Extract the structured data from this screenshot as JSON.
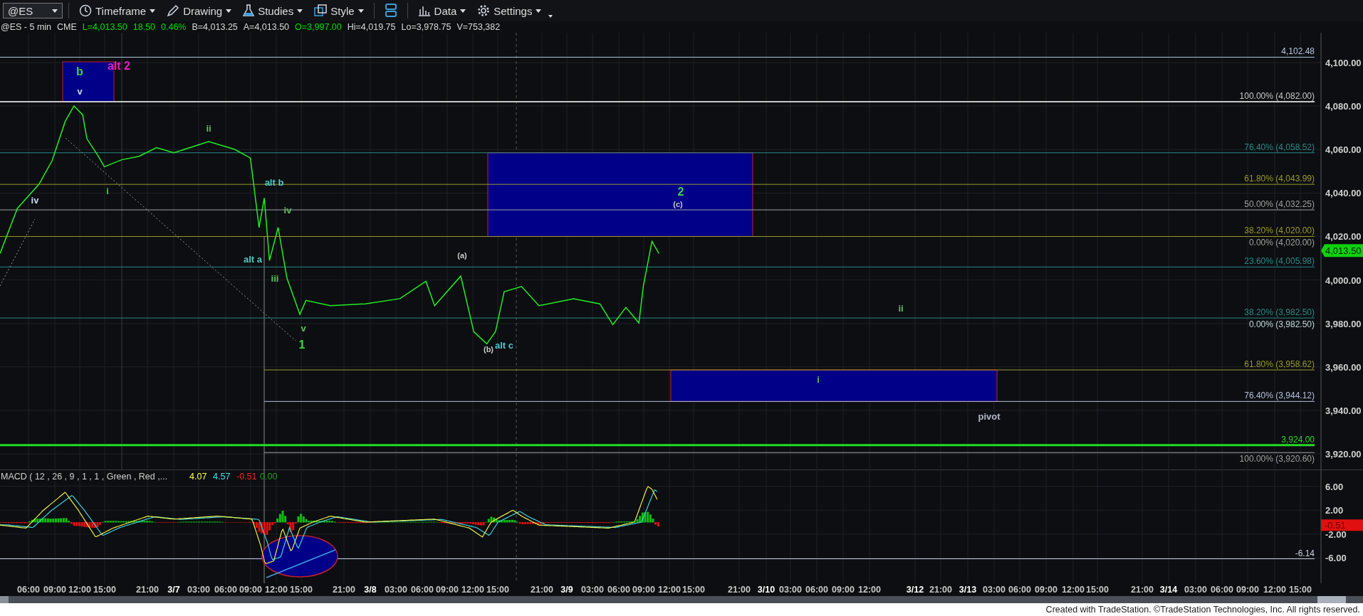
{
  "toolbar": {
    "symbol": "@ES",
    "buttons": [
      {
        "kind": "clock",
        "label": "Timeframe"
      },
      {
        "kind": "pencil",
        "label": "Drawing"
      },
      {
        "kind": "flask",
        "label": "Studies"
      },
      {
        "kind": "style",
        "label": "Style"
      },
      {
        "kind": "layout"
      },
      {
        "kind": "bars",
        "label": "Data"
      },
      {
        "kind": "gear",
        "label": "Settings"
      }
    ]
  },
  "quote_line": {
    "symbol": "@ES - 5 min",
    "exchange": "CME",
    "fields": [
      {
        "text": "L=4,013.50",
        "color": "#00e000"
      },
      {
        "text": "18.50",
        "color": "#00e000"
      },
      {
        "text": "0.46%",
        "color": "#00e000"
      },
      {
        "text": "B=4,013.25",
        "color": "#d8d8d8"
      },
      {
        "text": "A=4,013.50",
        "color": "#d8d8d8"
      },
      {
        "text": "O=3,997.00",
        "color": "#00e000"
      },
      {
        "text": "Hi=4,019.75",
        "color": "#d8d8d8"
      },
      {
        "text": "Lo=3,978.75",
        "color": "#d8d8d8"
      },
      {
        "text": "V=753,382",
        "color": "#d8d8d8"
      }
    ]
  },
  "price_chart": {
    "fib_levels": [
      {
        "label": "4,102.48",
        "color": "#b4c8e0"
      },
      {
        "label": "100.00% (4,082.00)",
        "color": "#c8c8c8"
      },
      {
        "label": "76.40% (4,058.52)",
        "color": "#2a8a86"
      },
      {
        "label": "61.80% (4,043.99)",
        "color": "#9a9a2a"
      },
      {
        "label": "50.00% (4,032.25)",
        "color": "#a0a0a0"
      },
      {
        "label": "38.20% (4,020.00)",
        "color": "#9a9a2a"
      },
      {
        "label": "0.00% (4,020.00)",
        "color": "#a0a0a0"
      },
      {
        "label": "23.60% (4,005.98)",
        "color": "#2a8a86"
      },
      {
        "label": "38.20% (3,982.50)",
        "color": "#2a8a86"
      },
      {
        "label": "0.00% (3,982.50)",
        "color": "#c0d8d8"
      },
      {
        "label": "61.80% (3,958.62)",
        "color": "#9a9a2a"
      },
      {
        "label": "76.40% (3,944.12)",
        "color": "#b4c0d8"
      },
      {
        "label": "3,924.00",
        "color": "#22dd22"
      },
      {
        "label": "100.00% (3,920.60)",
        "color": "#a0a0a0"
      }
    ],
    "wave_labels": [
      {
        "text": "b",
        "kind": "major",
        "color": "#3fd23f"
      },
      {
        "text": "alt 2",
        "kind": "major",
        "color": "#e020c0"
      },
      {
        "text": "v",
        "kind": "minor",
        "color": "#c8d8f0"
      },
      {
        "text": "iv",
        "kind": "minor",
        "color": "#c8d8f0"
      },
      {
        "text": "i",
        "kind": "minor",
        "color": "#5cc05c"
      },
      {
        "text": "ii",
        "kind": "minor",
        "color": "#5cc05c"
      },
      {
        "text": "alt b",
        "kind": "minor",
        "color": "#4fc8c8"
      },
      {
        "text": "iv",
        "kind": "minor",
        "color": "#5cc05c"
      },
      {
        "text": "alt a",
        "kind": "minor",
        "color": "#4fc8c8"
      },
      {
        "text": "iii",
        "kind": "minor",
        "color": "#5cc05c"
      },
      {
        "text": "v",
        "kind": "minor",
        "color": "#5cc05c"
      },
      {
        "text": "1",
        "kind": "major",
        "color": "#3fd23f"
      },
      {
        "text": "(a)",
        "kind": "small",
        "color": "#c8c8c8"
      },
      {
        "text": "2",
        "kind": "major",
        "color": "#3fd23f"
      },
      {
        "text": "(c)",
        "kind": "small",
        "color": "#c8c8c8"
      },
      {
        "text": "(b)",
        "kind": "small",
        "color": "#c8c8c8"
      },
      {
        "text": "alt c",
        "kind": "minor",
        "color": "#4fc8c8"
      },
      {
        "text": "ii",
        "kind": "minor",
        "color": "#5cc05c"
      },
      {
        "text": "i",
        "kind": "minor",
        "color": "#5cc05c"
      },
      {
        "text": "pivot",
        "kind": "minor",
        "color": "#b0b8c8"
      }
    ],
    "price_axis": [
      "4,100.00",
      "4,080.00",
      "4,060.00",
      "4,040.00",
      "4,020.00",
      "4,000.00",
      "3,980.00",
      "3,960.00",
      "3,940.00",
      "3,920.00"
    ],
    "last_price": "4,013.50"
  },
  "macd": {
    "title": "MACD ( 12 , 26 , 9 , 1 , 1 , Green , Red ,...",
    "values": [
      {
        "text": "4.07",
        "color": "#ffff40"
      },
      {
        "text": "4.57",
        "color": "#40e0e0"
      },
      {
        "text": "-0.51",
        "color": "#ff2020"
      },
      {
        "text": "0.00",
        "color": "#20a020"
      }
    ],
    "axis": [
      "6.00",
      "2.00",
      "-2.00",
      "-6.00"
    ],
    "last_value": "-0.51",
    "level_label": "-6.14"
  },
  "time_axis": [
    {
      "text": "06:00",
      "kind": "time"
    },
    {
      "text": "09:00",
      "kind": "time"
    },
    {
      "text": "12:00",
      "kind": "time"
    },
    {
      "text": "15:00",
      "kind": "time"
    },
    {
      "text": "21:00",
      "kind": "time"
    },
    {
      "text": "3/7",
      "kind": "date"
    },
    {
      "text": "03:00",
      "kind": "time"
    },
    {
      "text": "06:00",
      "kind": "time"
    },
    {
      "text": "09:00",
      "kind": "time"
    },
    {
      "text": "12:00",
      "kind": "time"
    },
    {
      "text": "15:00",
      "kind": "time"
    },
    {
      "text": "21:00",
      "kind": "time"
    },
    {
      "text": "3/8",
      "kind": "date"
    },
    {
      "text": "03:00",
      "kind": "time"
    },
    {
      "text": "06:00",
      "kind": "time"
    },
    {
      "text": "09:00",
      "kind": "time"
    },
    {
      "text": "12:00",
      "kind": "time"
    },
    {
      "text": "15:00",
      "kind": "time"
    },
    {
      "text": "21:00",
      "kind": "time"
    },
    {
      "text": "3/9",
      "kind": "date"
    },
    {
      "text": "03:00",
      "kind": "time"
    },
    {
      "text": "06:00",
      "kind": "time"
    },
    {
      "text": "09:00",
      "kind": "time"
    },
    {
      "text": "12:00",
      "kind": "time"
    },
    {
      "text": "15:00",
      "kind": "time"
    },
    {
      "text": "21:00",
      "kind": "time"
    },
    {
      "text": "3/10",
      "kind": "date"
    },
    {
      "text": "03:00",
      "kind": "time"
    },
    {
      "text": "06:00",
      "kind": "time"
    },
    {
      "text": "09:00",
      "kind": "time"
    },
    {
      "text": "12:00",
      "kind": "time"
    },
    {
      "text": "3/12",
      "kind": "date"
    },
    {
      "text": "21:00",
      "kind": "time"
    },
    {
      "text": "3/13",
      "kind": "date"
    },
    {
      "text": "03:00",
      "kind": "time"
    },
    {
      "text": "06:00",
      "kind": "time"
    },
    {
      "text": "09:00",
      "kind": "time"
    },
    {
      "text": "12:00",
      "kind": "time"
    },
    {
      "text": "15:00",
      "kind": "time"
    },
    {
      "text": "21:00",
      "kind": "time"
    },
    {
      "text": "3/14",
      "kind": "date"
    },
    {
      "text": "03:00",
      "kind": "time"
    },
    {
      "text": "06:00",
      "kind": "time"
    },
    {
      "text": "09:00",
      "kind": "time"
    },
    {
      "text": "12:00",
      "kind": "time"
    },
    {
      "text": "15:00",
      "kind": "time"
    }
  ],
  "footer": "Created with TradeStation. ©TradeStation Technologies, Inc. All rights reserved."
}
